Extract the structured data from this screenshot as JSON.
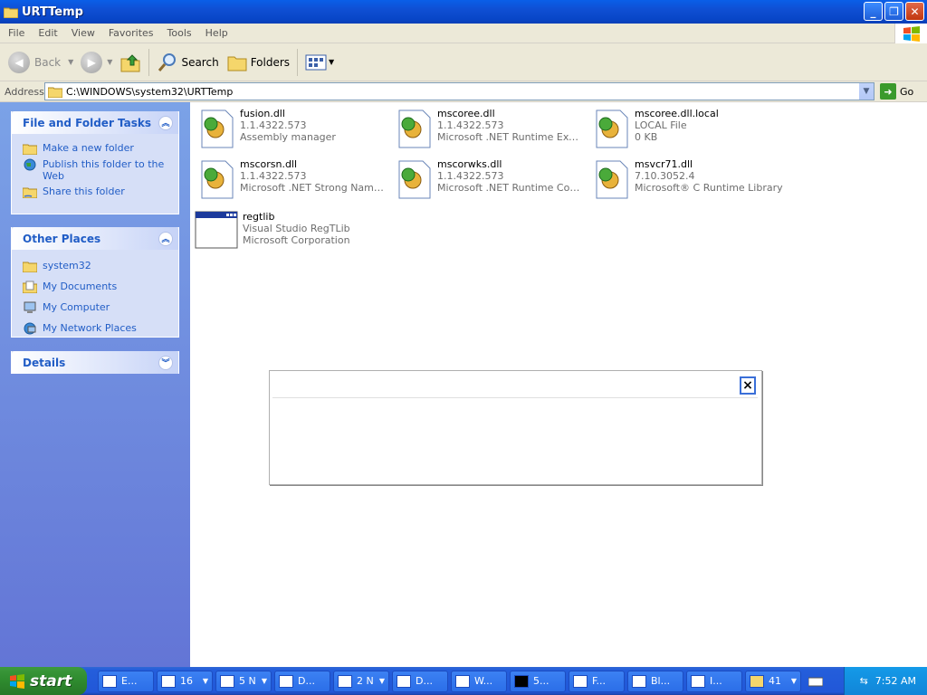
{
  "window": {
    "title": "URTTemp"
  },
  "menu": [
    "File",
    "Edit",
    "View",
    "Favorites",
    "Tools",
    "Help"
  ],
  "toolbar": {
    "back": "Back",
    "search": "Search",
    "folders": "Folders"
  },
  "address": {
    "label": "Address",
    "value": "C:\\WINDOWS\\system32\\URTTemp",
    "go": "Go"
  },
  "tasks": {
    "title": "File and Folder Tasks",
    "items": [
      "Make a new folder",
      "Publish this folder to the Web",
      "Share this folder"
    ]
  },
  "places": {
    "title": "Other Places",
    "items": [
      "system32",
      "My Documents",
      "My Computer",
      "My Network Places"
    ]
  },
  "details": {
    "title": "Details"
  },
  "files": [
    {
      "name": "fusion.dll",
      "line1": "1.1.4322.573",
      "line2": "Assembly manager"
    },
    {
      "name": "mscoree.dll",
      "line1": "1.1.4322.573",
      "line2": "Microsoft .NET Runtime Execu..."
    },
    {
      "name": "mscoree.dll.local",
      "line1": "LOCAL File",
      "line2": "0 KB"
    },
    {
      "name": "mscorsn.dll",
      "line1": "1.1.4322.573",
      "line2": "Microsoft .NET Strong Name S..."
    },
    {
      "name": "mscorwks.dll",
      "line1": "1.1.4322.573",
      "line2": "Microsoft .NET Runtime Comm..."
    },
    {
      "name": "msvcr71.dll",
      "line1": "7.10.3052.4",
      "line2": "Microsoft® C Runtime Library"
    },
    {
      "name": "regtlib",
      "line1": "Visual Studio RegTLib",
      "line2": "Microsoft Corporation"
    }
  ],
  "dialog": {
    "close": "×"
  },
  "taskbar": {
    "start": "start",
    "buttons": [
      "E...",
      "16",
      "5 N",
      "D...",
      "2 N",
      "D...",
      "W...",
      "5...",
      "F...",
      "Bl...",
      "I...",
      "41"
    ],
    "clock": "7:52 AM"
  }
}
